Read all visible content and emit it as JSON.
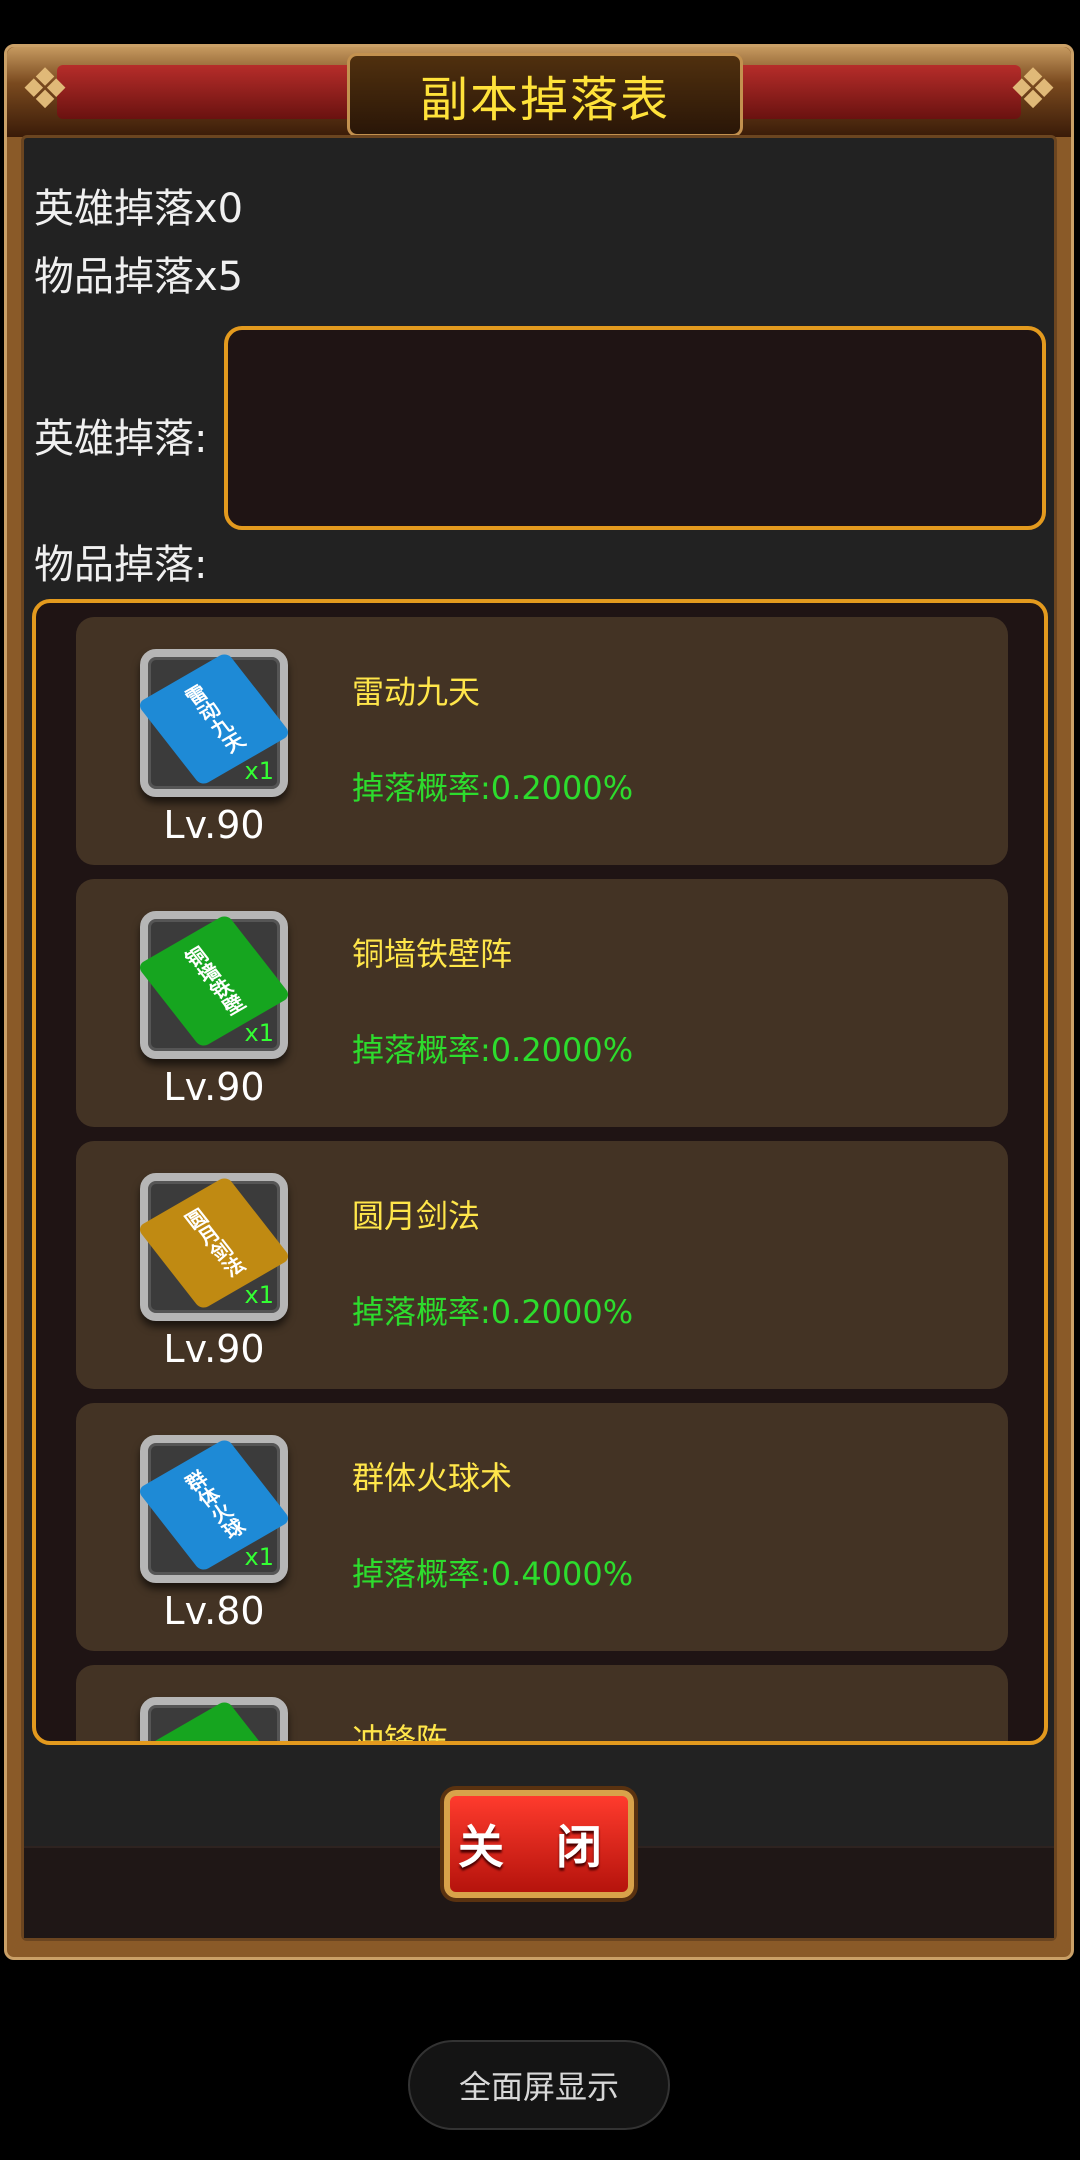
{
  "dialog": {
    "title": "副本掉落表",
    "hero_drop_count": "英雄掉落x0",
    "item_drop_count": "物品掉落x5",
    "hero_drop_label": "英雄掉落:",
    "item_drop_label": "物品掉落:",
    "close_label": "关 闭"
  },
  "items": [
    {
      "name": "雷动九天",
      "level": "Lv.90",
      "qty": "x1",
      "rate": "掉落概率:0.2000%",
      "book_text": "雷动九天",
      "book_color": "#1e8ad6"
    },
    {
      "name": "铜墙铁壁阵",
      "level": "Lv.90",
      "qty": "x1",
      "rate": "掉落概率:0.2000%",
      "book_text": "铜墙铁壁",
      "book_color": "#16a51f"
    },
    {
      "name": "圆月剑法",
      "level": "Lv.90",
      "qty": "x1",
      "rate": "掉落概率:0.2000%",
      "book_text": "圆月剑法",
      "book_color": "#c08a12"
    },
    {
      "name": "群体火球术",
      "level": "Lv.80",
      "qty": "x1",
      "rate": "掉落概率:0.4000%",
      "book_text": "群体火球",
      "book_color": "#1e8ad6"
    },
    {
      "name": "冲锋陈",
      "level": "",
      "qty": "",
      "rate": "",
      "book_text": "",
      "book_color": "#16a51f"
    }
  ],
  "system": {
    "fullscreen_label": "全面屏显示"
  },
  "colors": {
    "title": "#ffe23a",
    "item_name": "#ffe64a",
    "drop_rate": "#2ddc2d",
    "accent_border": "#e39a1e"
  }
}
